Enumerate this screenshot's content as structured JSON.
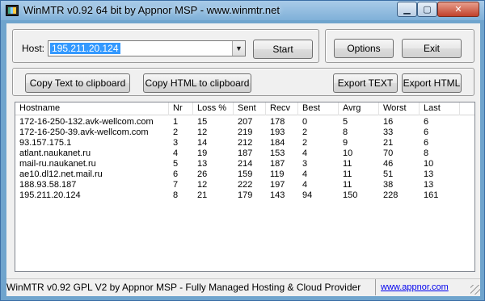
{
  "window": {
    "title": "WinMTR v0.92 64 bit by Appnor MSP - www.winmtr.net",
    "minimize_glyph": "▁",
    "maximize_glyph": "▢",
    "close_glyph": "✕"
  },
  "host": {
    "label": "Host:",
    "value": "195.211.20.124",
    "dropdown_glyph": "▼"
  },
  "buttons": {
    "start": "Start",
    "options": "Options",
    "exit": "Exit",
    "copy_text": "Copy Text to clipboard",
    "copy_html": "Copy HTML to clipboard",
    "export_text": "Export TEXT",
    "export_html": "Export HTML"
  },
  "table": {
    "columns": [
      "Hostname",
      "Nr",
      "Loss %",
      "Sent",
      "Recv",
      "Best",
      "Avrg",
      "Worst",
      "Last"
    ],
    "rows": [
      [
        "172-16-250-132.avk-wellcom.com",
        "1",
        "15",
        "207",
        "178",
        "0",
        "5",
        "16",
        "6"
      ],
      [
        "172-16-250-39.avk-wellcom.com",
        "2",
        "12",
        "219",
        "193",
        "2",
        "8",
        "33",
        "6"
      ],
      [
        "93.157.175.1",
        "3",
        "14",
        "212",
        "184",
        "2",
        "9",
        "21",
        "6"
      ],
      [
        "atlant.naukanet.ru",
        "4",
        "19",
        "187",
        "153",
        "4",
        "10",
        "70",
        "8"
      ],
      [
        "mail-ru.naukanet.ru",
        "5",
        "13",
        "214",
        "187",
        "3",
        "11",
        "46",
        "10"
      ],
      [
        "ae10.dl12.net.mail.ru",
        "6",
        "26",
        "159",
        "119",
        "4",
        "11",
        "51",
        "13"
      ],
      [
        "188.93.58.187",
        "7",
        "12",
        "222",
        "197",
        "4",
        "11",
        "38",
        "13"
      ],
      [
        "195.211.20.124",
        "8",
        "21",
        "179",
        "143",
        "94",
        "150",
        "228",
        "161"
      ]
    ]
  },
  "status": {
    "text": "WinMTR v0.92 GPL V2 by Appnor MSP - Fully Managed Hosting & Cloud Provider",
    "link": "www.appnor.com"
  }
}
